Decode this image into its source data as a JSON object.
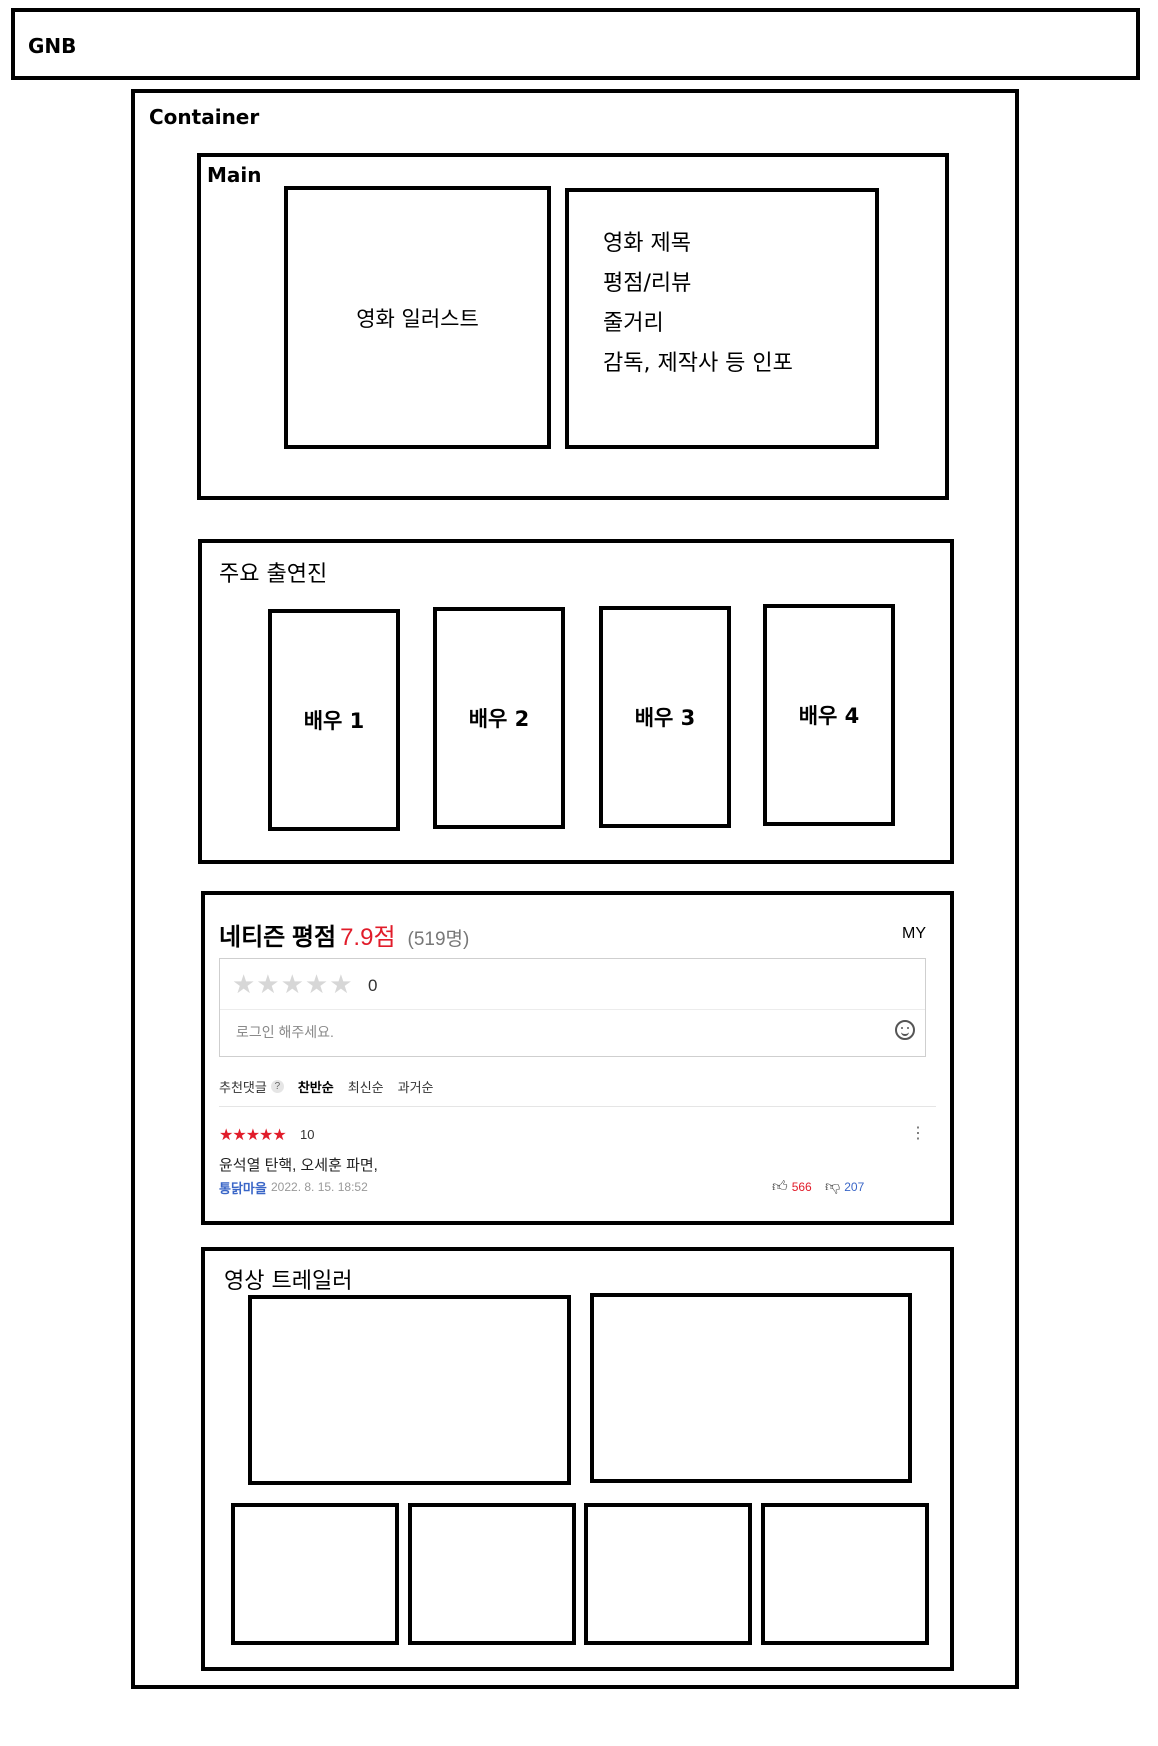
{
  "gnb": {
    "label": "GNB"
  },
  "container": {
    "label": "Container"
  },
  "main": {
    "label": "Main",
    "illustration": "영화 일러스트",
    "info_lines": [
      "영화 제목",
      "평점/리뷰",
      "줄거리",
      "감독, 제작사 등 인포"
    ]
  },
  "cast": {
    "label": "주요 출연진",
    "actors": [
      "배우 1",
      "배우 2",
      "배우 3",
      "배우 4"
    ]
  },
  "review": {
    "title": "네티즌 평점",
    "score": "7.9점",
    "count": "(519명)",
    "my": "MY",
    "empty_stars": "★★★★★",
    "star_value": "0",
    "placeholder": "로그인 해주세요.",
    "sort": {
      "recommended": "추천댓글",
      "help": "?",
      "pro_con": "찬반순",
      "latest": "최신순",
      "oldest": "과거순"
    },
    "comment": {
      "stars": "★★★★★",
      "score": "10",
      "text": "윤석열 탄핵, 오세훈 파면,",
      "user": "통닭마을",
      "date": "2022. 8. 15. 18:52",
      "likes": "566",
      "dislikes": "207",
      "more": "⋮"
    },
    "colors": {
      "accent": "#e11c2a",
      "link": "#3a66c7"
    }
  },
  "trailer": {
    "label": "영상 트레일러"
  }
}
